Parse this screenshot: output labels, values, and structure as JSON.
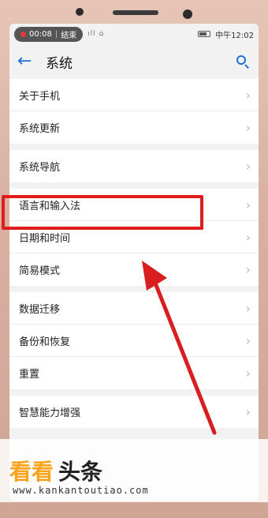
{
  "status": {
    "rec_time": "00:08",
    "rec_end": "结束",
    "signal": "ıll ⌂",
    "time_label": "中午12:02"
  },
  "appbar": {
    "title": "系统"
  },
  "groups": [
    [
      "关于手机",
      "系统更新"
    ],
    [
      "系统导航"
    ],
    [
      "语言和输入法",
      "日期和时间",
      "简易模式"
    ],
    [
      "数据迁移",
      "备份和恢复",
      "重置"
    ],
    [
      "智慧能力增强"
    ]
  ],
  "watermark": {
    "brand_cn": "看看",
    "brand_tail": "头条",
    "url": "www.kankantoutiao.com"
  },
  "colors": {
    "accent": "#1e72d6",
    "highlight": "#e01c1c",
    "arrow": "#d81e1e"
  }
}
